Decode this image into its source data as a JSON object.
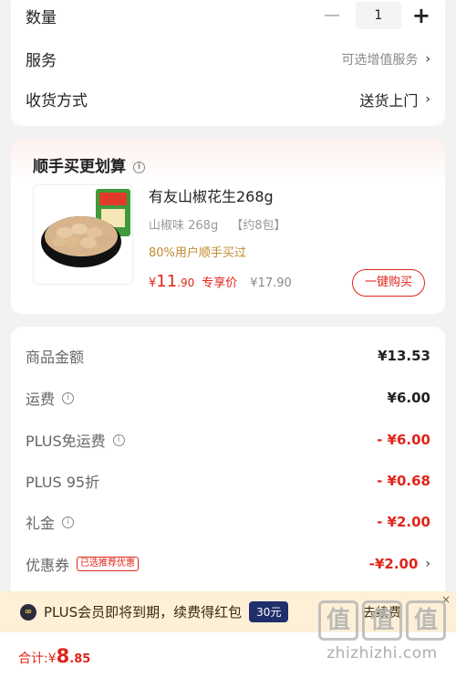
{
  "order_options": {
    "quantity_label": "数量",
    "quantity_value": "1",
    "minus_symbol": "−",
    "plus_symbol": "+",
    "service_label": "服务",
    "service_value": "可选增值服务",
    "delivery_label": "收货方式",
    "delivery_value": "送货上门",
    "chevron": "›"
  },
  "upsell": {
    "title": "顺手买更划算",
    "info_symbol": "i",
    "product": {
      "name": "有友山椒花生268g",
      "spec_flavor": "山椒味 268g",
      "spec_pack": "【约8包】",
      "hint": "80%用户顺手买过",
      "price_symbol": "¥",
      "price_int": "11",
      "price_dec": ".90",
      "price_tag": "专享价",
      "orig_price": "¥17.90",
      "buy_button": "一键购买"
    }
  },
  "fees": [
    {
      "label": "商品金额",
      "value": "¥13.53",
      "info": false,
      "red": false
    },
    {
      "label": "运费",
      "value": "¥6.00",
      "info": true,
      "red": false
    },
    {
      "label": "PLUS免运费",
      "value": "- ¥6.00",
      "info": true,
      "red": true
    },
    {
      "label": "PLUS 95折",
      "value": "- ¥0.68",
      "info": false,
      "red": true
    },
    {
      "label": "礼金",
      "value": "- ¥2.00",
      "info": true,
      "red": true
    },
    {
      "label": "优惠券",
      "value": "-¥2.00",
      "info": false,
      "red": true,
      "tag": "已选推荐优惠"
    }
  ],
  "banner": {
    "icon_text": "∞",
    "text": "PLUS会员即将到期，续费得红包",
    "pill": "30元",
    "action": "去续费",
    "close": "×"
  },
  "footer": {
    "total_label": "合计: ",
    "total_symbol": "¥",
    "total_int": "8",
    "total_dec": ".85"
  },
  "watermark": {
    "logo_chars": [
      "值",
      "值",
      "值"
    ],
    "text": "zhizhizhi.com"
  },
  "colors": {
    "accent_red": "#e1251b",
    "hint_gold": "#c08a2e",
    "banner_bg": "#fdf0d7",
    "pill_navy": "#1f2f6b"
  }
}
